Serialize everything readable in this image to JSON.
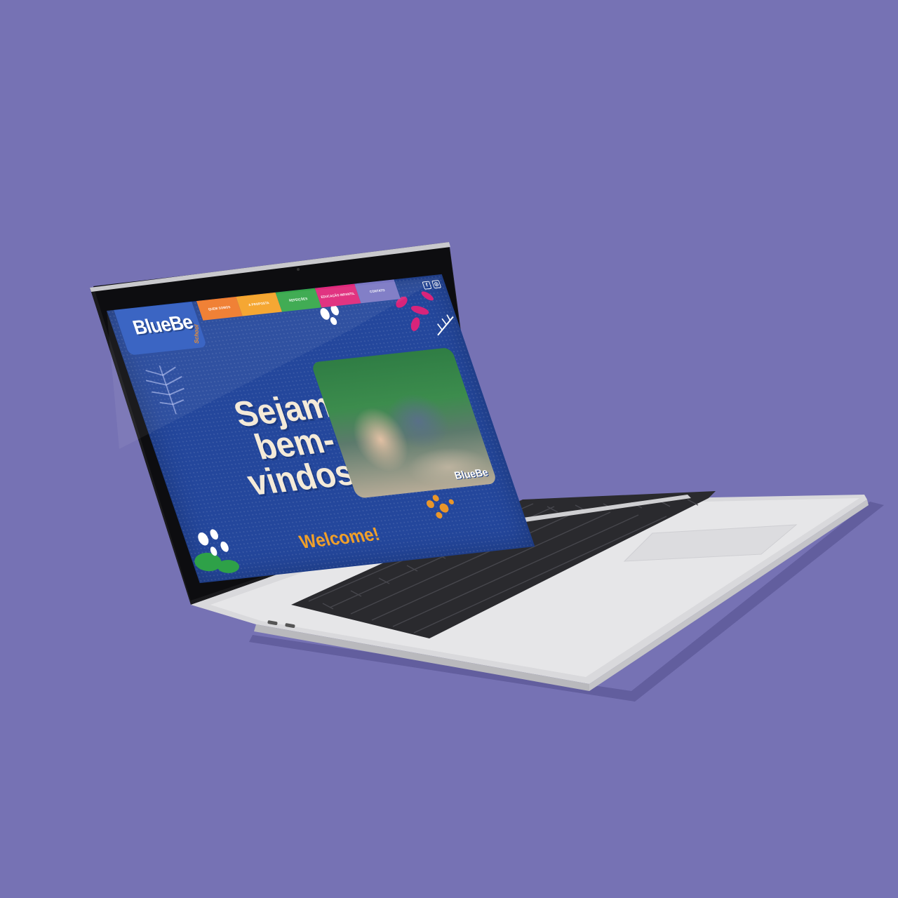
{
  "background_color": "#7672b4",
  "website": {
    "logo": {
      "text": "BlueBe",
      "subtext": "School"
    },
    "nav": {
      "items": [
        {
          "label": "QUEM SOMOS",
          "color": "#f07a2a"
        },
        {
          "label": "A PROPOSTA",
          "color": "#f5a227"
        },
        {
          "label": "REFEIÇÕES",
          "color": "#36a74a"
        },
        {
          "label": "EDUCAÇÃO INFANTIL",
          "color": "#e0287a"
        },
        {
          "label": "CONTATO",
          "color": "#7b78c4"
        }
      ]
    },
    "social": {
      "facebook_icon": "f",
      "instagram_icon": "◎"
    },
    "hero": {
      "title_line1": "Sejam",
      "title_line2": "bem-",
      "title_line3": "vindos!",
      "subtitle": "Welcome!"
    },
    "photo": {
      "watermark": "BlueBe"
    }
  },
  "colors": {
    "site_bg": "#24479c",
    "logo_box": "#2f5cc0",
    "accent_orange": "#f0a02a",
    "hero_text": "#f4ead8"
  }
}
